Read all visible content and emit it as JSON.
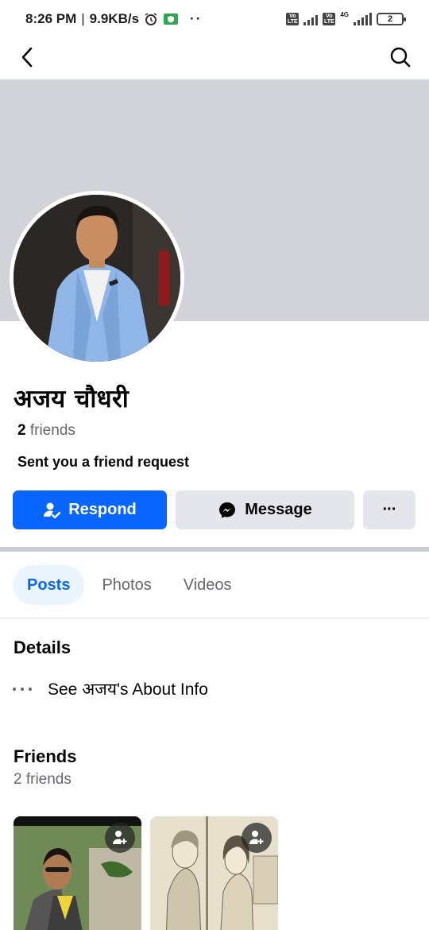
{
  "status_bar": {
    "time": "8:26 PM",
    "speed": "9.9KB/s",
    "separator": "|",
    "network_label": "4G",
    "battery_level": "2",
    "volte_label": "Vo\nLTE"
  },
  "nav": {
    "back_icon": "chevron-left-icon",
    "search_icon": "search-icon"
  },
  "profile": {
    "name": "अजय चौधरी",
    "friends_count": "2",
    "friends_label": "friends",
    "request_status": "Sent you a friend request"
  },
  "actions": {
    "respond_label": "Respond",
    "message_label": "Message",
    "more_label": "···"
  },
  "tabs": [
    {
      "label": "Posts",
      "active": true
    },
    {
      "label": "Photos",
      "active": false
    },
    {
      "label": "Videos",
      "active": false
    }
  ],
  "details": {
    "title": "Details",
    "about_link": "See अजय's About Info"
  },
  "friends_section": {
    "title": "Friends",
    "count_text": "2 friends"
  },
  "colors": {
    "accent": "#0866ff",
    "cover": "#d1d3d8",
    "secondary_button": "#e4e6eb"
  }
}
